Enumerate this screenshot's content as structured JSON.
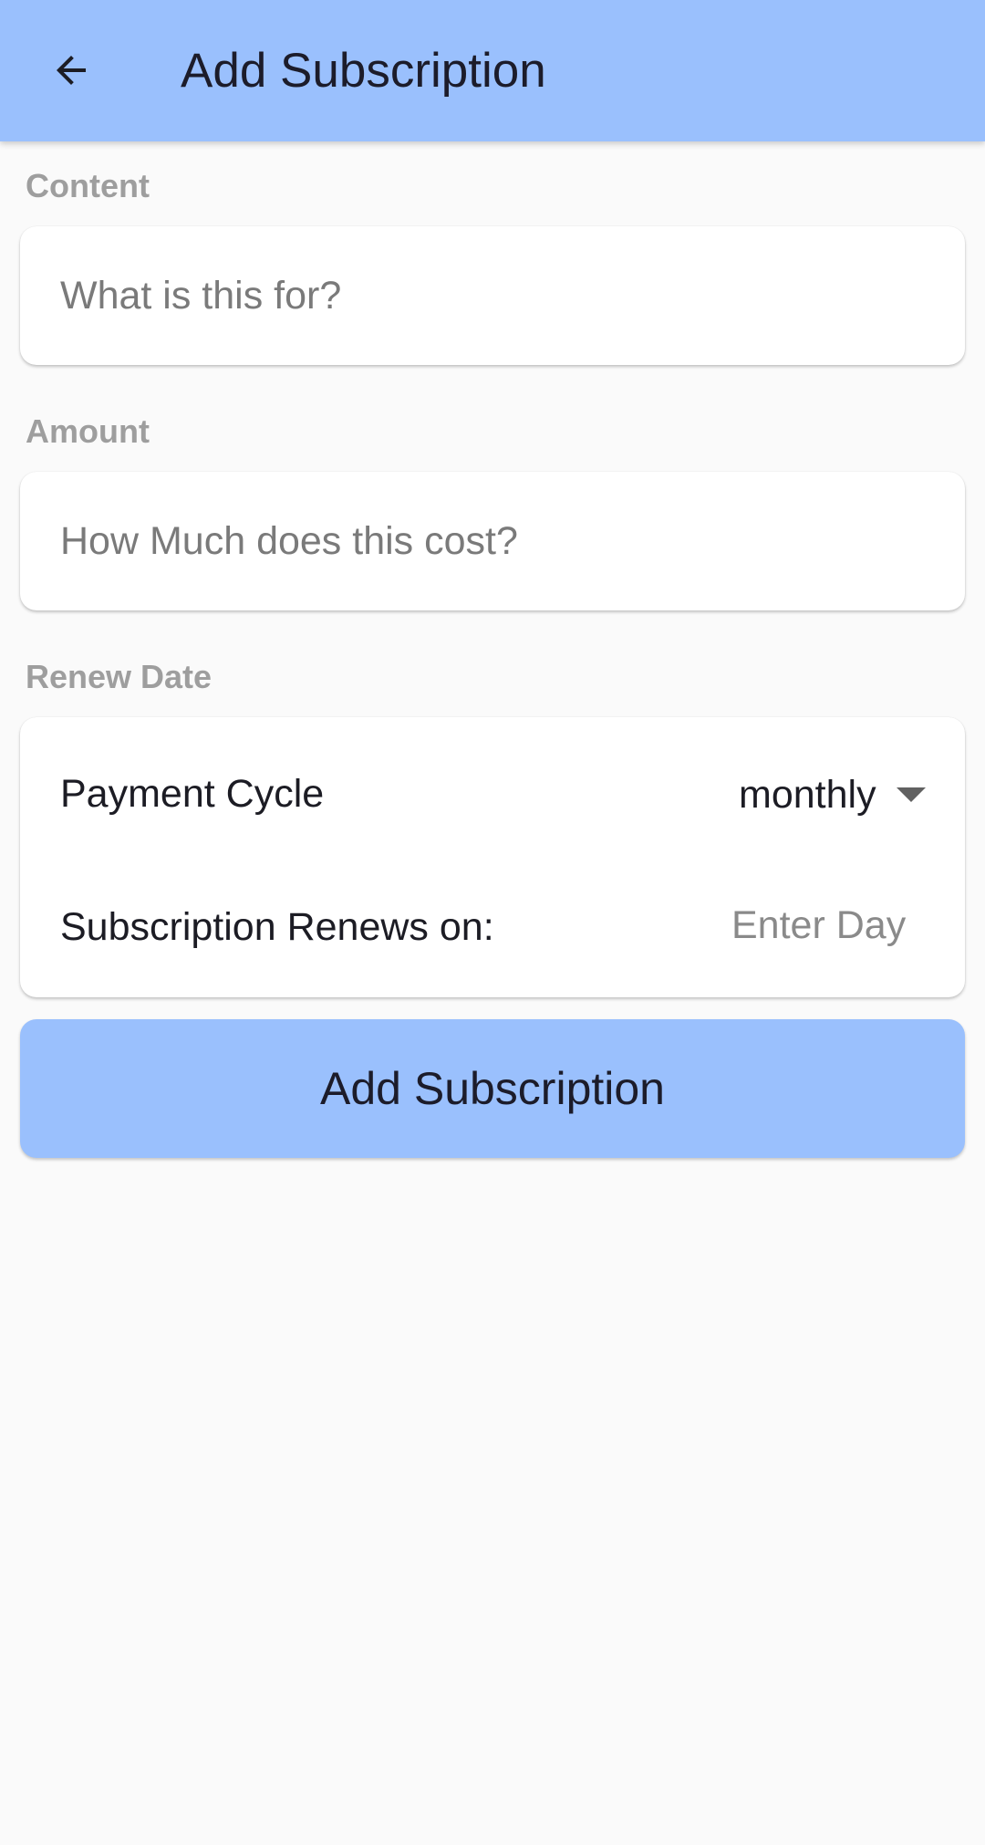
{
  "app_bar": {
    "title": "Add Subscription",
    "back_icon": "arrow-back-icon",
    "background_color": "#9ac0fd"
  },
  "content_section": {
    "label": "Content",
    "placeholder": "What is this for?",
    "value": ""
  },
  "amount_section": {
    "label": "Amount",
    "placeholder": "How Much does this cost?",
    "value": ""
  },
  "renew_section": {
    "label": "Renew Date",
    "payment_cycle_label": "Payment Cycle",
    "payment_cycle_value": "monthly",
    "dropdown_icon": "caret-down-icon",
    "renews_on_label": "Subscription Renews on:",
    "renews_on_placeholder": "Enter Day",
    "renews_on_value": ""
  },
  "submit": {
    "label": "Add Subscription",
    "color": "#9ac0fd"
  }
}
